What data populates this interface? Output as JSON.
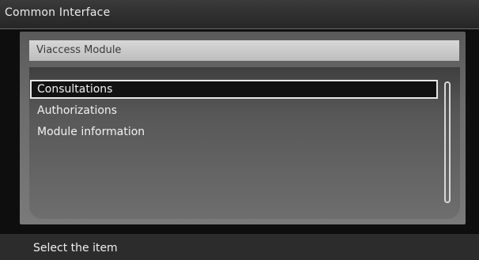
{
  "window": {
    "title": "Common Interface"
  },
  "module": {
    "title": "Viaccess Module"
  },
  "menu": {
    "items": [
      {
        "label": "Consultations",
        "selected": true
      },
      {
        "label": "Authorizations",
        "selected": false
      },
      {
        "label": "Module information",
        "selected": false
      }
    ]
  },
  "footer": {
    "hint": "Select the item"
  },
  "colors": {
    "selection_background": "#121212",
    "selection_border": "#e8e8e8",
    "header_bar": "#c8c8c8"
  }
}
